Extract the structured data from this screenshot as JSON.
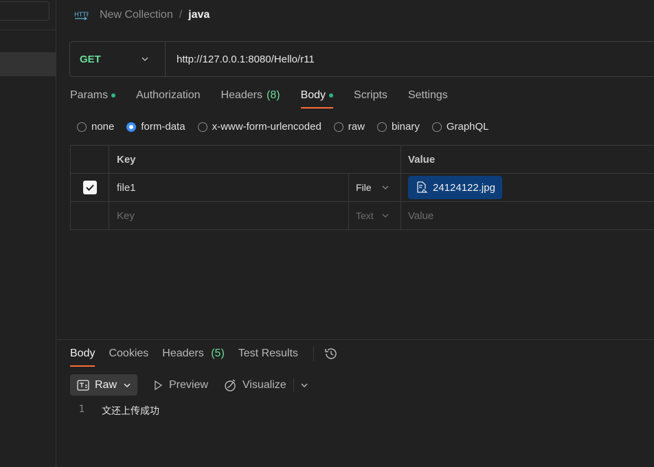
{
  "breadcrumb": {
    "collection": "New Collection",
    "separator": "/",
    "request": "java"
  },
  "request": {
    "method": "GET",
    "url": "http://127.0.0.1:8080/Hello/r11"
  },
  "request_tabs": [
    {
      "label": "Params",
      "dot": true
    },
    {
      "label": "Authorization"
    },
    {
      "label": "Headers",
      "count": "(8)"
    },
    {
      "label": "Body",
      "dot": true,
      "active": true
    },
    {
      "label": "Scripts"
    },
    {
      "label": "Settings"
    }
  ],
  "body_types": [
    "none",
    "form-data",
    "x-www-form-urlencoded",
    "raw",
    "binary",
    "GraphQL"
  ],
  "body_type_selected": "form-data",
  "form_table": {
    "headers": {
      "key": "Key",
      "value": "Value"
    },
    "rows": [
      {
        "checked": true,
        "key": "file1",
        "type": "File",
        "value": "24124122.jpg"
      }
    ],
    "empty_row": {
      "key_placeholder": "Key",
      "type": "Text",
      "value_placeholder": "Value"
    }
  },
  "response_tabs": [
    {
      "label": "Body",
      "active": true
    },
    {
      "label": "Cookies"
    },
    {
      "label": "Headers",
      "count": "(5)"
    },
    {
      "label": "Test Results"
    }
  ],
  "response_view": {
    "raw": "Raw",
    "preview": "Preview",
    "visualize": "Visualize"
  },
  "response_body": {
    "line_number": "1",
    "text": "文还上传成功"
  },
  "colors": {
    "background": "#212121",
    "method_get": "#6bdd9a",
    "accent": "#ff6c37",
    "dot": "#2fb67c",
    "file_chip": "#0d3e7a",
    "radio_selected": "#3a8ef6"
  }
}
